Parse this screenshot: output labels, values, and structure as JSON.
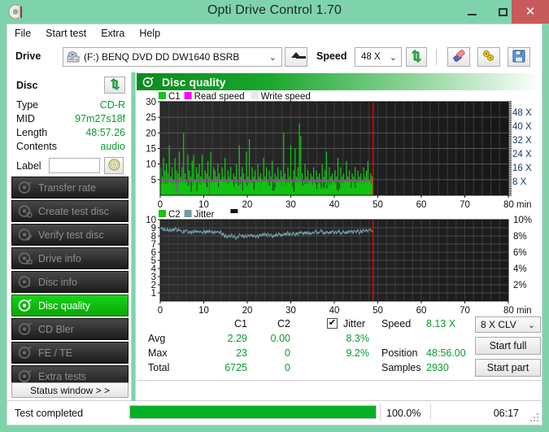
{
  "window": {
    "title": "Opti Drive Control 1.70",
    "app_icon": "disc-icon",
    "minimize": "–",
    "maximize": "□",
    "close": "✕"
  },
  "menubar": {
    "items": [
      "File",
      "Start test",
      "Extra",
      "Help"
    ]
  },
  "toolbar": {
    "drive_label": "Drive",
    "drive_value": "(F:)   BENQ DVD DD DW1640 BSRB",
    "drive_chevron": "⌄",
    "eject_name": "eject-button",
    "speed_label": "Speed",
    "speed_value": "48 X",
    "speed_chevron": "⌄",
    "refresh_name": "refresh-icon",
    "erase_name": "erase-icon",
    "tools_name": "tools-icon",
    "save_name": "save-icon"
  },
  "disc_panel": {
    "title": "Disc",
    "refresh_name": "refresh-icon",
    "rows": [
      {
        "key": "Type",
        "value": "CD-R"
      },
      {
        "key": "MID",
        "value": "97m27s18f"
      },
      {
        "key": "Length",
        "value": "48:57.26"
      },
      {
        "key": "Contents",
        "value": "audio"
      }
    ],
    "label_key": "Label",
    "label_value": "",
    "label_placeholder": "",
    "label_button_name": "disc-label-icon"
  },
  "nav": {
    "items": [
      {
        "label": "Transfer rate",
        "icon": "disc-transfer-icon",
        "active": false
      },
      {
        "label": "Create test disc",
        "icon": "disc-create-icon",
        "active": false
      },
      {
        "label": "Verify test disc",
        "icon": "disc-verify-icon",
        "active": false
      },
      {
        "label": "Drive info",
        "icon": "disc-drive-icon",
        "active": false
      },
      {
        "label": "Disc info",
        "icon": "disc-info-icon",
        "active": false
      },
      {
        "label": "Disc quality",
        "icon": "disc-quality-icon",
        "active": true
      },
      {
        "label": "CD Bler",
        "icon": "disc-bler-icon",
        "active": false
      },
      {
        "label": "FE / TE",
        "icon": "disc-fete-icon",
        "active": false
      },
      {
        "label": "Extra tests",
        "icon": "disc-extra-icon",
        "active": false
      }
    ],
    "status_window": "Status window > >"
  },
  "panel": {
    "header_title": "Disc quality",
    "header_icon": "disc-quality-icon"
  },
  "chart_data": [
    {
      "type": "bar",
      "name": "c1-chart",
      "title": "",
      "legend": [
        {
          "label": "C1",
          "color": "#13c413"
        },
        {
          "label": "Read speed",
          "color": "#ff00ff"
        },
        {
          "label": "Write speed",
          "color": "#e8e8e8"
        }
      ],
      "xlabel": "min",
      "ylabel": "",
      "xlim": [
        0,
        80
      ],
      "ylim": [
        0,
        30
      ],
      "xticks": [
        0,
        10,
        20,
        30,
        40,
        50,
        60,
        70,
        80
      ],
      "xticklabels": [
        "0",
        "10",
        "20",
        "30",
        "40",
        "50",
        "60",
        "70",
        "80 min"
      ],
      "yticks": [
        5,
        10,
        15,
        20,
        25,
        30
      ],
      "yticklabels": [
        "5",
        "10",
        "15",
        "20",
        "25",
        "30"
      ],
      "y2ticks": [
        8,
        16,
        24,
        32,
        40,
        48
      ],
      "y2ticklabels": [
        "8 X",
        "16 X",
        "24 X",
        "32 X",
        "40 X",
        "48 X"
      ],
      "y2lim": [
        0,
        54
      ],
      "grid": true,
      "cursor_x": 48.93,
      "data_end_x": 48.93,
      "read_speed_line": 8.13,
      "series": [
        {
          "name": "C1",
          "color": "#13c413",
          "x_start": 0,
          "x_end": 48.93,
          "values": [
            9,
            6,
            12,
            8,
            10,
            7,
            16,
            6,
            9,
            5,
            12,
            8,
            7,
            14,
            6,
            9,
            20,
            7,
            5,
            13,
            8,
            6,
            11,
            13,
            5,
            9,
            7,
            10,
            6,
            13,
            5,
            8,
            7,
            11,
            6,
            14,
            5,
            9,
            8,
            6,
            10,
            7,
            5,
            9,
            6,
            12,
            5,
            8,
            6,
            9,
            5,
            7,
            6,
            10,
            5,
            16,
            6,
            9,
            7,
            5,
            14,
            6,
            18,
            5,
            9,
            6,
            8,
            5,
            10,
            6,
            7,
            5,
            12,
            6,
            9,
            5,
            8,
            6,
            11,
            5,
            7,
            6,
            9,
            5,
            8,
            6,
            20,
            7,
            5,
            9,
            6,
            16,
            5,
            8,
            15,
            6,
            9,
            23,
            19,
            7,
            5,
            10,
            6,
            8,
            5,
            7,
            6,
            9,
            5,
            8,
            6,
            7,
            5,
            10,
            6,
            8,
            14,
            5,
            9,
            6,
            7,
            5,
            8,
            6,
            12,
            5,
            9,
            6,
            7,
            5,
            11,
            6,
            8,
            5,
            7,
            6,
            9,
            5,
            8,
            6,
            7,
            5,
            9,
            6,
            8,
            11,
            5,
            7,
            6
          ]
        }
      ],
      "avg": 2.29,
      "max": 23,
      "total": 6725
    },
    {
      "type": "line",
      "name": "c2-jitter-chart",
      "title": "",
      "legend": [
        {
          "label": "C2",
          "color": "#13c413"
        },
        {
          "label": "Jitter",
          "color": "#6f9ca3"
        }
      ],
      "xlabel": "min",
      "ylabel": "",
      "xlim": [
        0,
        80
      ],
      "ylim": [
        0,
        10
      ],
      "xticks": [
        0,
        10,
        20,
        30,
        40,
        50,
        60,
        70,
        80
      ],
      "xticklabels": [
        "0",
        "10",
        "20",
        "30",
        "40",
        "50",
        "60",
        "70",
        "80 min"
      ],
      "yticks": [
        1,
        2,
        3,
        4,
        5,
        6,
        7,
        8,
        9,
        10
      ],
      "yticklabels": [
        "1",
        "2",
        "3",
        "4",
        "5",
        "6",
        "7",
        "8",
        "9",
        "10"
      ],
      "y2ticks": [
        2,
        4,
        6,
        8,
        10
      ],
      "y2ticklabels": [
        "2%",
        "4%",
        "6%",
        "8%",
        "10%"
      ],
      "grid": true,
      "cursor_x": 48.93,
      "series": [
        {
          "name": "Jitter",
          "color": "#6f9ca3",
          "x_start": 0,
          "x_end": 48.93,
          "values": [
            8.9,
            9.0,
            8.7,
            8.9,
            8.6,
            8.8,
            8.5,
            8.8,
            8.6,
            8.9,
            8.7,
            9.0,
            8.6,
            8.8,
            8.5,
            8.7,
            8.4,
            8.6,
            8.5,
            8.7,
            8.4,
            8.6,
            8.3,
            8.5,
            8.4,
            8.7,
            8.5,
            8.6,
            8.4,
            8.5,
            8.3,
            8.6,
            8.4,
            8.6,
            8.5,
            8.7,
            8.4,
            8.5,
            8.3,
            8.5,
            8.4,
            8.6,
            8.3,
            8.5,
            8.2,
            8.4,
            7.9,
            8.1,
            7.8,
            8.0,
            7.9,
            8.1,
            7.8,
            8.0,
            7.7,
            7.9,
            8.0,
            8.2,
            7.9,
            8.1,
            7.8,
            8.0,
            7.9,
            8.2,
            8.0,
            8.2,
            7.9,
            8.1,
            7.8,
            8.0,
            7.9,
            8.1,
            8.0,
            8.3,
            8.1,
            8.3,
            8.0,
            8.2,
            8.0,
            8.2,
            7.9,
            8.1,
            8.0,
            8.2,
            8.1,
            8.3,
            8.0,
            8.2,
            8.1,
            8.3,
            8.2,
            8.4,
            8.1,
            8.3,
            8.2,
            8.4,
            8.1,
            8.3,
            8.2,
            8.4,
            8.3,
            8.5,
            8.2,
            8.4,
            8.3,
            8.5,
            8.2,
            8.4,
            8.3,
            8.5,
            8.4,
            8.6,
            8.3,
            8.5,
            8.4,
            8.7,
            8.5,
            8.3,
            8.4,
            8.6,
            8.3,
            8.5,
            8.4,
            8.6,
            8.3,
            8.5,
            8.4,
            8.6,
            8.5,
            8.3,
            8.4,
            8.6,
            8.3,
            8.5,
            8.4,
            8.6,
            8.5,
            8.7,
            8.4,
            8.6,
            8.5,
            8.7,
            8.4,
            8.6,
            8.5,
            8.7,
            8.6,
            8.8,
            8.5,
            8.7,
            8.9,
            8.6
          ]
        },
        {
          "name": "C2",
          "color": "#13c413",
          "x_start": 0,
          "x_end": 48.93,
          "values": []
        }
      ],
      "avg": "0.00",
      "max": 0,
      "total": 0,
      "jitter_avg": "8.3%",
      "jitter_max": "9.2%"
    }
  ],
  "stats": {
    "col_headers": [
      "C1",
      "C2"
    ],
    "row_headers": [
      "Avg",
      "Max",
      "Total"
    ],
    "c1": [
      "2.29",
      "23",
      "6725"
    ],
    "c2": [
      "0.00",
      "0",
      "0"
    ],
    "jitter_label": "Jitter",
    "jitter_checked": true,
    "jitter_check_glyph": "✔",
    "jitter_values": [
      "8.3%",
      "9.2%"
    ],
    "speed_label": "Speed",
    "speed_value": "8.13 X",
    "position_label": "Position",
    "position_value": "48:56.00",
    "samples_label": "Samples",
    "samples_value": "2930",
    "clv_value": "8 X CLV",
    "clv_chevron": "⌄",
    "start_full": "Start full",
    "start_part": "Start part"
  },
  "statusbar": {
    "text": "Test completed",
    "progress_percent": 100.0,
    "percent_label": "100.0%",
    "elapsed": "06:17"
  }
}
